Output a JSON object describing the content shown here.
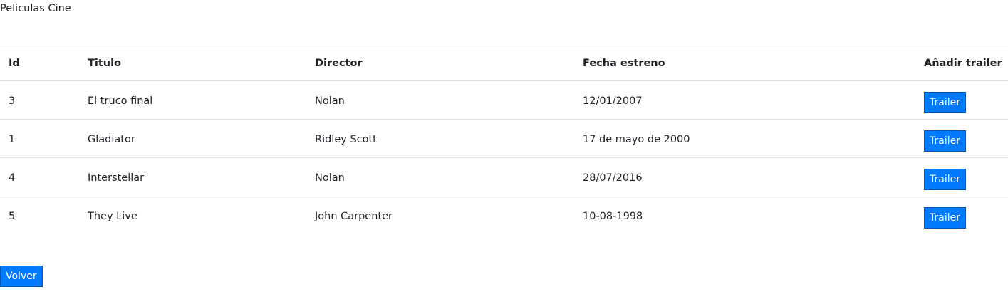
{
  "page": {
    "title": "Peliculas Cine"
  },
  "table": {
    "headers": {
      "id": "Id",
      "titulo": "Titulo",
      "director": "Director",
      "fecha": "Fecha estreno",
      "trailer": "Añadir trailer"
    },
    "rows": [
      {
        "id": "3",
        "titulo": "El truco final",
        "director": "Nolan",
        "fecha": "12/01/2007",
        "trailer_label": "Trailer"
      },
      {
        "id": "1",
        "titulo": "Gladiator",
        "director": "Ridley Scott",
        "fecha": "17 de mayo de 2000",
        "trailer_label": "Trailer"
      },
      {
        "id": "4",
        "titulo": "Interstellar",
        "director": "Nolan",
        "fecha": "28/07/2016",
        "trailer_label": "Trailer"
      },
      {
        "id": "5",
        "titulo": "They Live",
        "director": "John Carpenter",
        "fecha": "10-08-1998",
        "trailer_label": "Trailer"
      }
    ]
  },
  "actions": {
    "volver_label": "Volver"
  },
  "colors": {
    "primary": "#007bff",
    "border": "#dee2e6",
    "text": "#212529"
  }
}
